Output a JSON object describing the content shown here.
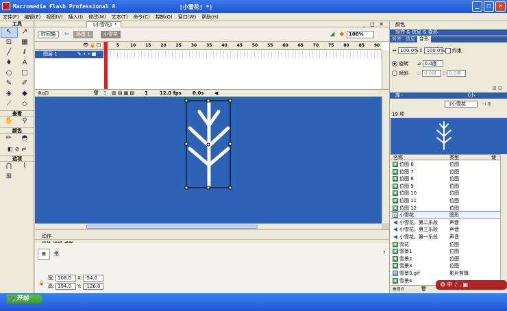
{
  "window": {
    "title": "Macromedia Flash Professional 8",
    "document": "[小雪花] *]",
    "minimize": "_",
    "maximize": "□",
    "close": "✕"
  },
  "menu": [
    "文件(F)",
    "编辑(E)",
    "视图(V)",
    "插入(I)",
    "修改(M)",
    "文本(T)",
    "命令(C)",
    "控制(O)",
    "窗口(W)",
    "帮助(H)"
  ],
  "tools": {
    "title": "工具",
    "view_label": "查看",
    "colors_label": "颜色",
    "options_label": "选项",
    "items": [
      {
        "name": "arrow-tool-icon",
        "glyph": "↖"
      },
      {
        "name": "subselect-tool-icon",
        "glyph": "↗"
      },
      {
        "name": "free-transform-tool-icon",
        "glyph": "⊡"
      },
      {
        "name": "fill-transform-tool-icon",
        "glyph": "▦"
      },
      {
        "name": "line-tool-icon",
        "glyph": "╱"
      },
      {
        "name": "lasso-tool-icon",
        "glyph": "ℓ"
      },
      {
        "name": "pen-tool-icon",
        "glyph": "♦"
      },
      {
        "name": "text-tool-icon",
        "glyph": "A"
      },
      {
        "name": "oval-tool-icon",
        "glyph": "○"
      },
      {
        "name": "rectangle-tool-icon",
        "glyph": "□"
      },
      {
        "name": "pencil-tool-icon",
        "glyph": "✎"
      },
      {
        "name": "brush-tool-icon",
        "glyph": "✐"
      },
      {
        "name": "ink-bottle-tool-icon",
        "glyph": "◈"
      },
      {
        "name": "paint-bucket-tool-icon",
        "glyph": "◆"
      },
      {
        "name": "eyedropper-tool-icon",
        "glyph": "⟋"
      },
      {
        "name": "eraser-tool-icon",
        "glyph": "◇"
      }
    ],
    "view_items": [
      {
        "name": "hand-tool-icon",
        "glyph": "✋"
      },
      {
        "name": "zoom-tool-icon",
        "glyph": "⚲"
      }
    ],
    "color_items": [
      {
        "name": "stroke-color-icon",
        "glyph": "✏"
      },
      {
        "name": "fill-color-icon",
        "glyph": "◓"
      }
    ],
    "swatch_items": [
      {
        "name": "black-white-icon",
        "glyph": "◧"
      },
      {
        "name": "no-color-icon",
        "glyph": "⊘"
      },
      {
        "name": "swap-colors-icon",
        "glyph": "⇄"
      }
    ],
    "option_items": [
      {
        "name": "snap-magnet-icon",
        "glyph": "⋂"
      },
      {
        "name": "smooth-option-icon",
        "glyph": "⌇"
      },
      {
        "name": "straighten-option-icon",
        "glyph": "⊞"
      }
    ]
  },
  "document_tab": "《小雪花》*",
  "editbar": {
    "timeline_button": "时间轴",
    "scene": "场景 1",
    "symbol": "小雪花",
    "zoom": "100%"
  },
  "timeline": {
    "frame_numbers": [
      "1",
      "5",
      "10",
      "15",
      "20",
      "25",
      "30",
      "35",
      "40",
      "45",
      "50",
      "55",
      "60",
      "65",
      "70",
      "75",
      "80",
      "85",
      "90"
    ],
    "layer_name": "图层 1",
    "current_frame": "1",
    "fps": "12.0 fps",
    "elapsed": "0.0s"
  },
  "properties": {
    "actions_label": "动作",
    "tabs_label": "属性  滤镜  参数",
    "kind": "组",
    "width_label": "宽:",
    "width": "108.0",
    "height_label": "高:",
    "height": "194.0",
    "x_label": "X:",
    "x": "-54.0",
    "y_label": "Y:",
    "y": "-126.0"
  },
  "right": {
    "color_panel": "颜色",
    "align_panel": "对齐 & 信息 & 变形",
    "tabs": [
      "对齐",
      "信息",
      "变形"
    ],
    "scale_w": "100.0%",
    "scale_h": "100.0%",
    "constrain": "约束",
    "rotate_label": "旋转",
    "rotate_value": "0.0度",
    "skew_label": "倾斜",
    "skew_h": "0.0度",
    "skew_v": "0.0度",
    "library_label": "库 -",
    "library_doc": "《小雪花",
    "item_count": "19 项",
    "col_name": "名称",
    "col_type": "类型",
    "col_use": "使",
    "items": [
      {
        "name": "位图 6",
        "type": "位图",
        "kind": "bmp"
      },
      {
        "name": "位图 7",
        "type": "位图",
        "kind": "bmp"
      },
      {
        "name": "位图 8",
        "type": "位图",
        "kind": "bmp"
      },
      {
        "name": "位图 9",
        "type": "位图",
        "kind": "bmp"
      },
      {
        "name": "位图 10",
        "type": "位图",
        "kind": "bmp"
      },
      {
        "name": "位图 11",
        "type": "位图",
        "kind": "bmp"
      },
      {
        "name": "位图 12",
        "type": "位图",
        "kind": "bmp"
      },
      {
        "name": "小雪花",
        "type": "图形",
        "kind": "grf",
        "selected": true
      },
      {
        "name": "小雪花，第二乐段",
        "type": "声音",
        "kind": "snd"
      },
      {
        "name": "小雪花，第三乐段",
        "type": "声音",
        "kind": "snd"
      },
      {
        "name": "小雪花，第一乐段",
        "type": "声音",
        "kind": "snd"
      },
      {
        "name": "雪花",
        "type": "位图",
        "kind": "bmp"
      },
      {
        "name": "雪景1",
        "type": "位图",
        "kind": "bmp"
      },
      {
        "name": "雪景2",
        "type": "位图",
        "kind": "bmp"
      },
      {
        "name": "雪景3",
        "type": "位图",
        "kind": "bmp"
      },
      {
        "name": "雪景3.gif",
        "type": "影片剪辑",
        "kind": "mc"
      },
      {
        "name": "雪景4",
        "type": "",
        "kind": "bmp"
      }
    ]
  },
  "taskbar": {
    "start": "开始",
    "tray_text": "中 ♪ ,"
  }
}
